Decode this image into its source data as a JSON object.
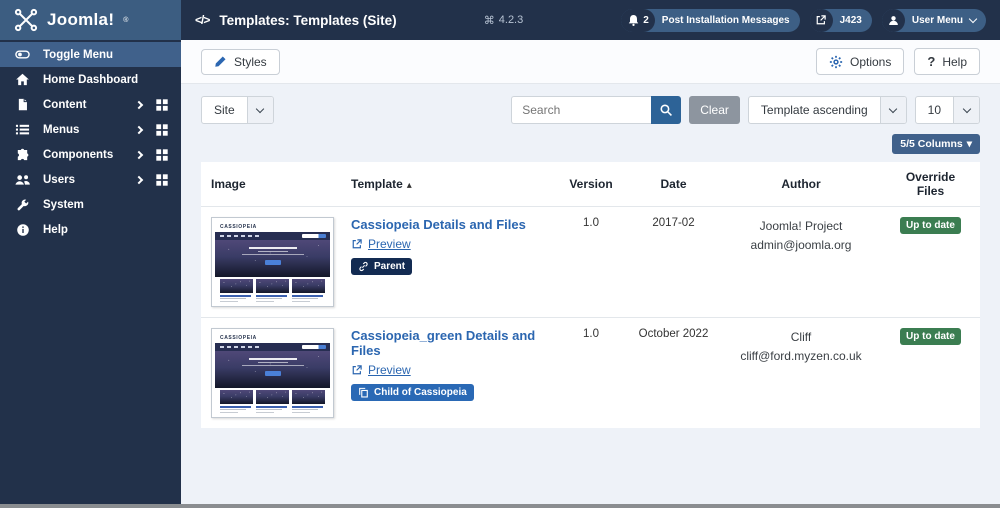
{
  "colors": {
    "header_bg": "#22314a",
    "logo_bg": "#3c5d81",
    "sidebar_bg": "#22314a",
    "sidebar_active_bg": "#40618b",
    "accent_blue": "#2c67b1",
    "link_blue": "#2b66b0",
    "search_button_bg": "#2d6397",
    "clear_button_bg": "#8d959f",
    "columns_button_bg": "#40618b",
    "badge_parent_bg": "#132b52",
    "badge_child_bg": "#2a69b5",
    "badge_success_bg": "#3b7d51",
    "content_bg": "#eef2f8",
    "pill_bg": "#3d5f85",
    "pill_icon_bg": "#22314a"
  },
  "topbar": {
    "logo_text": "Joomla!",
    "logo_mark": "®",
    "title_icon": "</>",
    "page_title": "Templates: Templates (Site)",
    "version": "4.2.3",
    "version_glyph": "⌘",
    "messages": {
      "count": "2",
      "label": "Post Installation Messages"
    },
    "site_link_label": "J423",
    "user_menu_label": "User Menu"
  },
  "sidebar": {
    "items": [
      {
        "label": "Toggle Menu"
      },
      {
        "label": "Home Dashboard"
      },
      {
        "label": "Content"
      },
      {
        "label": "Menus"
      },
      {
        "label": "Components"
      },
      {
        "label": "Users"
      },
      {
        "label": "System"
      },
      {
        "label": "Help"
      }
    ]
  },
  "toolbar": {
    "styles_label": "Styles",
    "options_label": "Options",
    "help_label": "Help",
    "help_glyph": "?"
  },
  "filters": {
    "client_select_value": "Site",
    "search_placeholder": "Search",
    "clear_label": "Clear",
    "sort_select_value": "Template ascending",
    "limit_select_value": "10",
    "columns_button_label": "5/5 Columns"
  },
  "table": {
    "headers": {
      "image": "Image",
      "template": "Template",
      "version": "Version",
      "date": "Date",
      "author": "Author",
      "override": "Override Files"
    },
    "rows": [
      {
        "title": "Cassiopeia Details and Files",
        "preview": "Preview",
        "badge": "Parent",
        "version": "1.0",
        "date": "2017-02",
        "author_name": "Joomla! Project",
        "author_email": "admin@joomla.org",
        "override": "Up to date"
      },
      {
        "title": "Cassiopeia_green Details and Files",
        "preview": "Preview",
        "badge": "Child of Cassiopeia",
        "version": "1.0",
        "date": "October 2022",
        "author_name": "Cliff",
        "author_email": "cliff@ford.myzen.co.uk",
        "override": "Up to date"
      }
    ]
  },
  "thumbnail": {
    "site_title": "CASSIOPEIA"
  }
}
